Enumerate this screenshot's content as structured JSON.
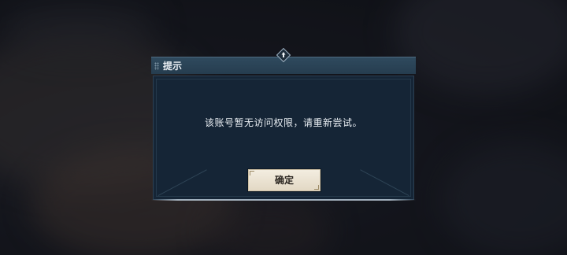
{
  "dialog": {
    "title": "提示",
    "message": "该账号暂无访问权限，请重新尝试。",
    "confirm_label": "确定"
  },
  "colors": {
    "header": "#2f4a5e",
    "body": "#152536",
    "button": "#f3ede0",
    "text": "#e9eef3"
  },
  "icons": {
    "ornament": "diamond-ornament-icon",
    "grip": "grip-dots-icon"
  }
}
